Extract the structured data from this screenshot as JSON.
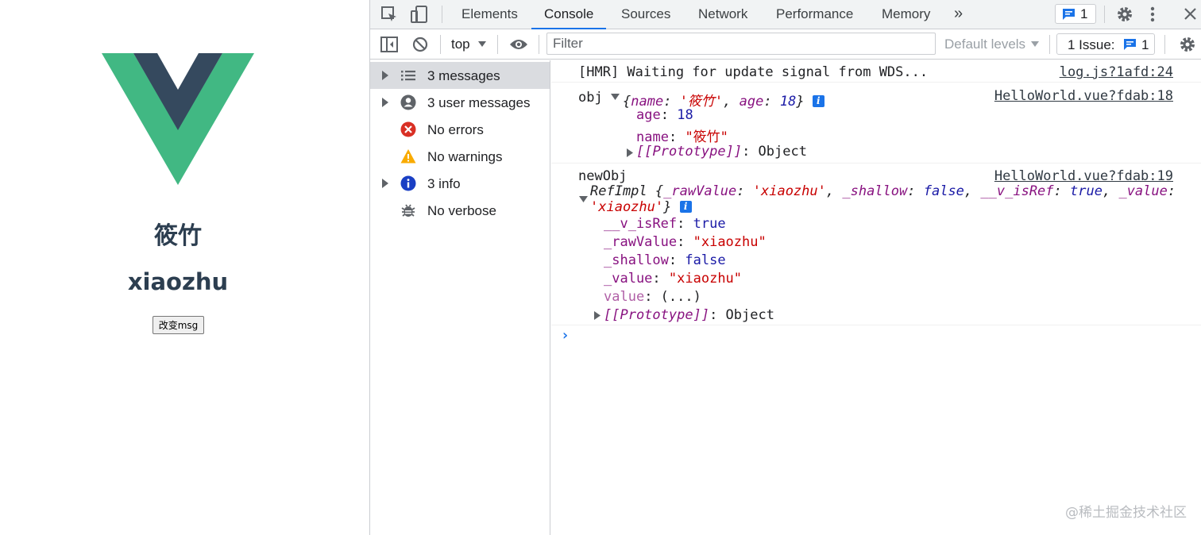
{
  "app": {
    "title_cn": "筱竹",
    "title_en": "xiaozhu",
    "button_label": "改变msg",
    "logo_colors": {
      "outer": "#41b883",
      "inner": "#35495e"
    }
  },
  "devtools": {
    "tabs": [
      "Elements",
      "Console",
      "Sources",
      "Network",
      "Performance",
      "Memory"
    ],
    "active_tab": "Console",
    "more_tabs": "»",
    "messages_badge": "1",
    "toolbar": {
      "context": "top",
      "filter_placeholder": "Filter",
      "default_levels": "Default levels",
      "issues_label": "1 Issue:",
      "issues_count": "1"
    },
    "sidebar": [
      {
        "label": "3 messages",
        "icon": "list-icon",
        "expandable": true,
        "selected": true
      },
      {
        "label": "3 user messages",
        "icon": "user-icon",
        "expandable": true,
        "selected": false
      },
      {
        "label": "No errors",
        "icon": "error-icon",
        "expandable": false,
        "selected": false
      },
      {
        "label": "No warnings",
        "icon": "warning-icon",
        "expandable": false,
        "selected": false
      },
      {
        "label": "3 info",
        "icon": "info-icon",
        "expandable": true,
        "selected": false
      },
      {
        "label": "No verbose",
        "icon": "bug-icon",
        "expandable": false,
        "selected": false
      }
    ],
    "console": {
      "msg1": {
        "text": "[HMR] Waiting for update signal from WDS...",
        "source": "log.js?1afd:24"
      },
      "msg2": {
        "label": "obj",
        "preview_name_key": "name",
        "preview_name_val": "'筱竹'",
        "preview_age_key": "age",
        "preview_age_val": "18",
        "age_key": "age",
        "age_val": "18",
        "name_key": "name",
        "name_val": "\"筱竹\"",
        "proto_key": "[[Prototype]]",
        "proto_val": "Object",
        "source": "HelloWorld.vue?fdab:18"
      },
      "msg3": {
        "label": "newObj",
        "source": "HelloWorld.vue?fdab:19",
        "class_name": "RefImpl",
        "p_rawValue_key": "_rawValue",
        "p_rawValue_val": "'xiaozhu'",
        "p_shallow_key": "_shallow",
        "p_shallow_val": "false",
        "p_isRef_key": "__v_isRef",
        "p_isRef_val": "true",
        "p_value_key": "_value",
        "p_value_val": "'xiaozhu'",
        "isRef_key": "__v_isRef",
        "isRef_val": "true",
        "rawValue_key": "_rawValue",
        "rawValue_val": "\"xiaozhu\"",
        "shallow_key": "_shallow",
        "shallow_val": "false",
        "value_key": "_value",
        "value_val": "\"xiaozhu\"",
        "getter_key": "value",
        "getter_val": "(...)",
        "proto_key": "[[Prototype]]",
        "proto_val": "Object"
      },
      "prompt": "›"
    },
    "watermark": "@稀土掘金技术社区"
  }
}
